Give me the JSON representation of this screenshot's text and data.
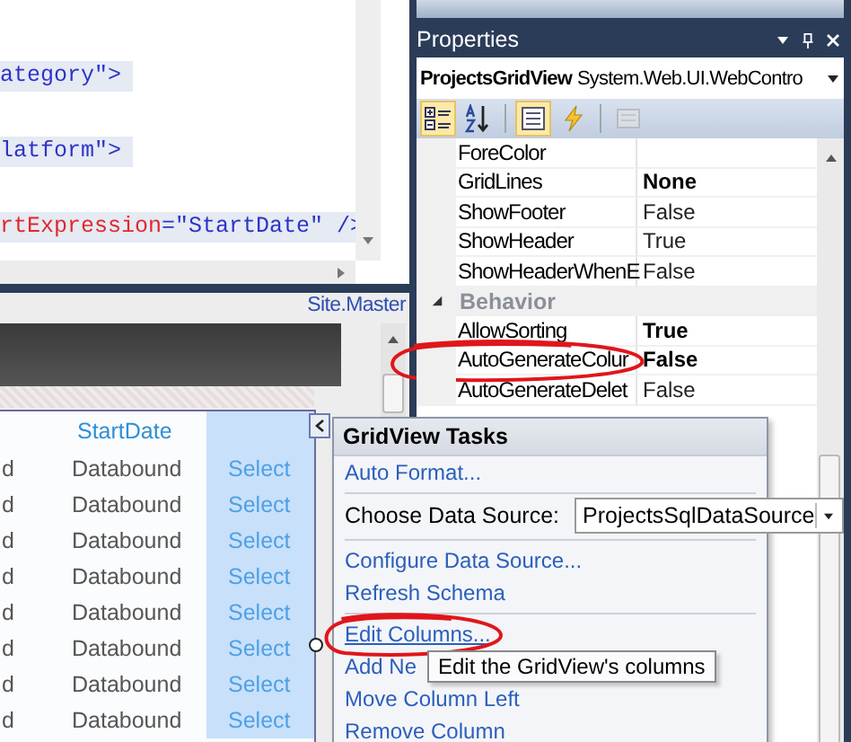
{
  "code_editor": {
    "lines": [
      {
        "parts": [
          {
            "kind": "markup",
            "text": "ategory\">"
          }
        ]
      },
      {
        "parts": [
          {
            "kind": "markup",
            "text": "latform\">"
          }
        ]
      },
      {
        "parts": [
          {
            "kind": "attribute",
            "text": "rtExpression"
          },
          {
            "kind": "markup",
            "text": "="
          },
          {
            "kind": "value",
            "text": "\"StartDate\""
          },
          {
            "kind": "markup",
            "text": " />"
          }
        ]
      }
    ]
  },
  "designer": {
    "file_tab": "Site.Master",
    "columns": [
      {
        "kind": "bound",
        "selected": false
      },
      {
        "kind": "bound",
        "header": "StartDate",
        "selected": false
      },
      {
        "kind": "command",
        "selected": true
      }
    ],
    "rows": [
      {
        "cells": [
          "d",
          "Databound",
          "Select"
        ]
      },
      {
        "cells": [
          "d",
          "Databound",
          "Select"
        ]
      },
      {
        "cells": [
          "d",
          "Databound",
          "Select"
        ]
      },
      {
        "cells": [
          "d",
          "Databound",
          "Select"
        ]
      },
      {
        "cells": [
          "d",
          "Databound",
          "Select"
        ]
      },
      {
        "cells": [
          "d",
          "Databound",
          "Select"
        ]
      },
      {
        "cells": [
          "d",
          "Databound",
          "Select"
        ]
      },
      {
        "cells": [
          "d",
          "Databound",
          "Select"
        ]
      }
    ]
  },
  "properties": {
    "title": "Properties",
    "object_name": "ProjectsGridView",
    "object_type": "System.Web.UI.WebContro",
    "toolbar": [
      {
        "kind": "categorized",
        "selected": true,
        "disabled": false
      },
      {
        "kind": "alphabetical",
        "selected": false,
        "disabled": false
      },
      {
        "kind": "properties",
        "selected": true,
        "disabled": false
      },
      {
        "kind": "events",
        "selected": false,
        "disabled": false
      },
      {
        "kind": "pages",
        "selected": false,
        "disabled": true
      }
    ],
    "rows": [
      {
        "kind": "property",
        "name": "ForeColor",
        "circled": false
      },
      {
        "kind": "property",
        "name": "GridLines",
        "value": "None",
        "modified": true,
        "circled": false
      },
      {
        "kind": "property",
        "name": "ShowFooter",
        "value": "False",
        "modified": false,
        "circled": false
      },
      {
        "kind": "property",
        "name": "ShowHeader",
        "value": "True",
        "modified": false,
        "circled": false
      },
      {
        "kind": "property",
        "name": "ShowHeaderWhenE",
        "value": "False",
        "modified": false,
        "circled": false
      },
      {
        "kind": "category",
        "name": "Behavior",
        "expanded": true
      },
      {
        "kind": "property",
        "name": "AllowSorting",
        "value": "True",
        "modified": true,
        "circled": false
      },
      {
        "kind": "property",
        "name": "AutoGenerateColur",
        "value": "False",
        "modified": true,
        "circled": true
      },
      {
        "kind": "property",
        "name": "AutoGenerateDelet",
        "value": "False",
        "modified": false,
        "circled": false
      }
    ]
  },
  "tasks": {
    "title": "GridView Tasks",
    "items": [
      {
        "kind": "link",
        "text": "Auto Format...",
        "circled": false
      },
      {
        "kind": "separator"
      },
      {
        "kind": "dropdown",
        "label": "Choose Data Source:",
        "value": "ProjectsSqlDataSource"
      },
      {
        "kind": "separator"
      },
      {
        "kind": "link",
        "text": "Configure Data Source...",
        "circled": false
      },
      {
        "kind": "link",
        "text": "Refresh Schema",
        "circled": false
      },
      {
        "kind": "separator"
      },
      {
        "kind": "link",
        "text": "Edit Columns...",
        "circled": true
      },
      {
        "kind": "link",
        "text": "Add Ne",
        "circled": false
      },
      {
        "kind": "link",
        "text": "Move Column Left",
        "circled": false
      },
      {
        "kind": "link",
        "text": "Remove Column",
        "circled": false
      }
    ],
    "tooltip": "Edit the GridView's columns"
  }
}
